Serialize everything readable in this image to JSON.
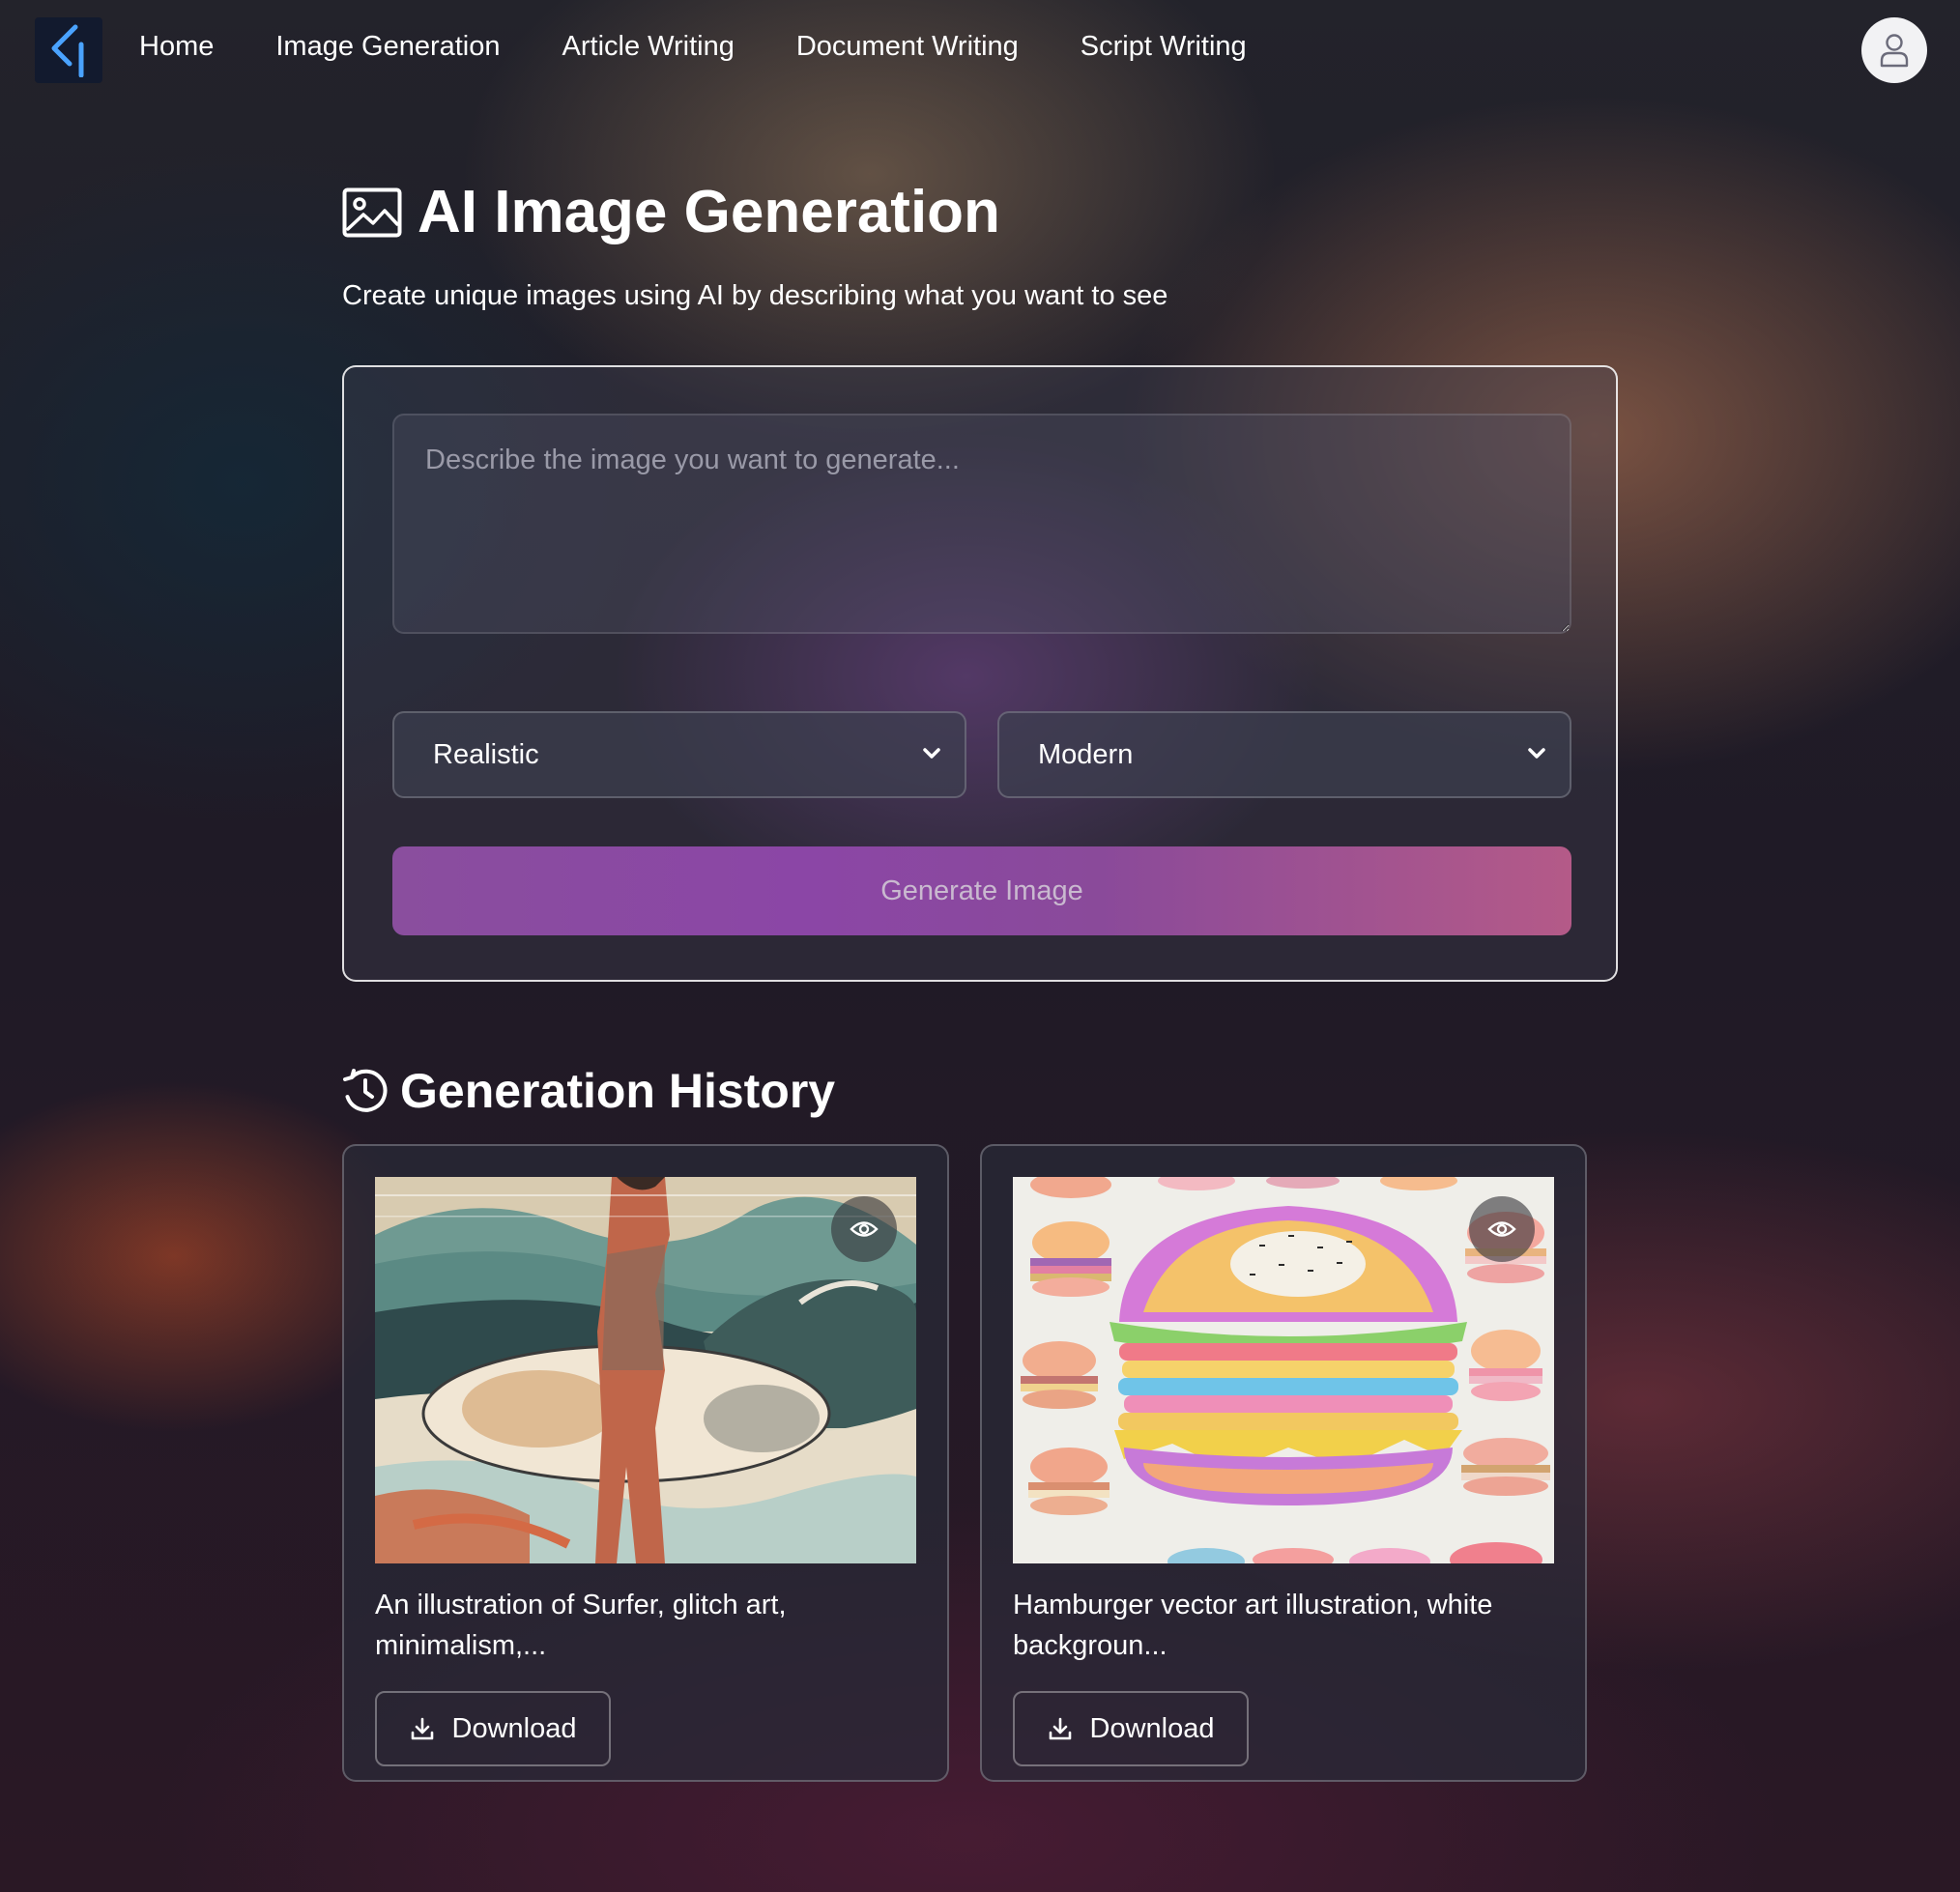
{
  "nav": {
    "links": [
      "Home",
      "Image Generation",
      "Article Writing",
      "Document Writing",
      "Script Writing"
    ]
  },
  "header": {
    "title": "AI Image Generation",
    "subtitle": "Create unique images using AI by describing what you want to see"
  },
  "form": {
    "prompt_placeholder": "Describe the image you want to generate...",
    "prompt_value": "",
    "style_select": "Realistic",
    "mood_select": "Modern",
    "generate_label": "Generate Image"
  },
  "history": {
    "title": "Generation History",
    "items": [
      {
        "caption": "An illustration of Surfer, glitch art, minimalism,...",
        "download_label": "Download",
        "thumbnail": "surfer-illustration"
      },
      {
        "caption": "Hamburger vector art illustration, white backgroun...",
        "download_label": "Download",
        "thumbnail": "hamburger-illustration"
      }
    ]
  },
  "icons": {
    "logo": "chevron-logo-icon",
    "avatar": "user-icon",
    "title": "image-icon",
    "history": "history-clock-icon",
    "select": "chevron-down-icon",
    "eye": "eye-icon",
    "download": "download-icon"
  },
  "colors": {
    "accent_start": "#8a4e9e",
    "accent_end": "#b45a88",
    "logo_blue": "#4aa3ff"
  }
}
